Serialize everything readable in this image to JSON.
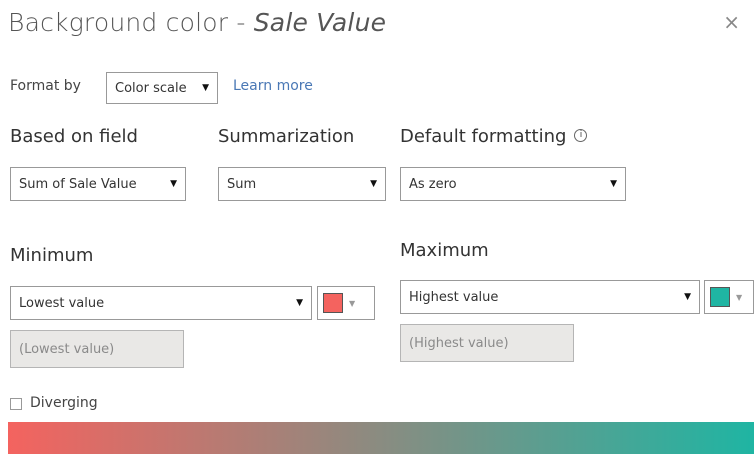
{
  "dialog": {
    "title_prefix": "Background color - ",
    "title_field": "Sale Value",
    "close_glyph": "×"
  },
  "format_by": {
    "label": "Format by",
    "value": "Color scale",
    "learn_more": "Learn more"
  },
  "based_on_field": {
    "label": "Based on field",
    "value": "Sum of Sale Value"
  },
  "summarization": {
    "label": "Summarization",
    "value": "Sum"
  },
  "default_formatting": {
    "label": "Default formatting",
    "info_glyph": "i",
    "value": "As zero"
  },
  "minimum": {
    "label": "Minimum",
    "value": "Lowest value",
    "input_placeholder": "(Lowest value)",
    "color": "#f4635f"
  },
  "maximum": {
    "label": "Maximum",
    "value": "Highest value",
    "input_placeholder": "(Highest value)",
    "color": "#1fb5a3"
  },
  "diverging": {
    "label": "Diverging",
    "checked": false
  },
  "icons": {
    "dropdown_arrow": "▼",
    "color_caret": "▼"
  },
  "gradient": {
    "from": "#f4635f",
    "to": "#1fb5a3"
  }
}
